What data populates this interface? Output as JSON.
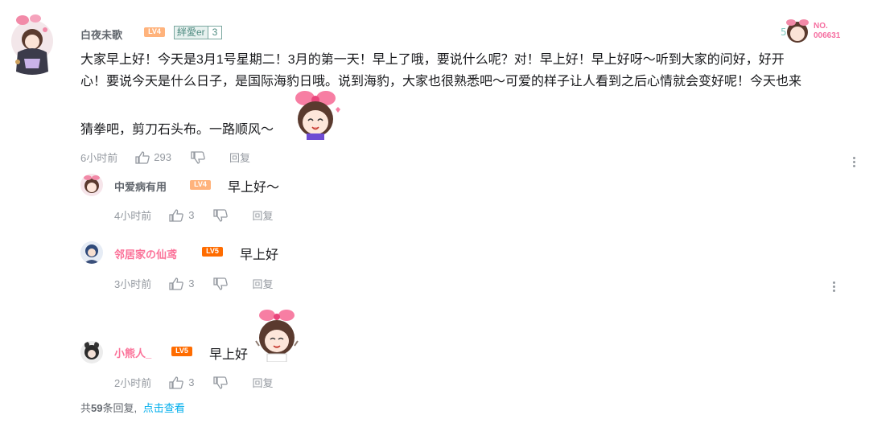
{
  "main_comment": {
    "username": "白夜未歌",
    "level": "LV4",
    "fan_badge": {
      "name": "絆愛er",
      "level": "3"
    },
    "nft_label": "NO.\n006631",
    "content_lines": [
      "大家早上好！今天是3月1号星期二！3月的第一天！早上了哦，要说什么呢？对！早上好！早上好呀～听到大家的问好，好开",
      "心！要说今天是什么日子，是国际海豹日哦。说到海豹，大家也很熟悉吧～可爱的样子让人看到之后心情就会变好呢！今天也来",
      "猜拳吧，剪刀石头布。一路顺风～"
    ],
    "time": "6小时前",
    "likes": "293",
    "reply_label": "回复"
  },
  "replies": [
    {
      "username": "中爱病有用",
      "level": "LV4",
      "text": "早上好～",
      "time": "4小时前",
      "likes": "3",
      "reply_label": "回复"
    },
    {
      "username": "邻居家の仙鸢",
      "level": "LV5",
      "text": "早上好",
      "time": "3小时前",
      "likes": "3",
      "reply_label": "回复"
    },
    {
      "username": "小熊人_",
      "level": "LV5",
      "text": "早上好",
      "time": "2小时前",
      "likes": "3",
      "reply_label": "回复"
    }
  ],
  "footer": {
    "prefix": "共",
    "count": "59",
    "suffix": "条回复,",
    "link": "点击查看"
  },
  "colors": {
    "pink": "#fb7299",
    "lv4": "#ffb37c",
    "lv5": "#ff6c00",
    "link": "#00aeec",
    "meta": "#9499a0"
  }
}
